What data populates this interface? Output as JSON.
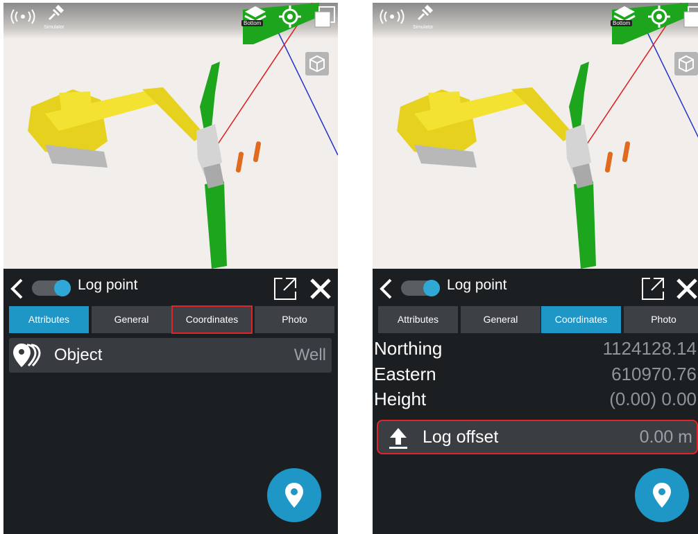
{
  "left_screen": {
    "status": {
      "simulator_label": "Simulator",
      "view_label": "Bottom"
    },
    "header": {
      "title": "Log point"
    },
    "tabs": [
      {
        "label": "Attributes",
        "active": true,
        "highlighted": false
      },
      {
        "label": "General",
        "active": false,
        "highlighted": false
      },
      {
        "label": "Coordinates",
        "active": false,
        "highlighted": true
      },
      {
        "label": "Photo",
        "active": false,
        "highlighted": false
      }
    ],
    "attribute_row": {
      "label": "Object",
      "value": "Well"
    }
  },
  "right_screen": {
    "status": {
      "simulator_label": "Simulator",
      "view_label": "Bottom"
    },
    "header": {
      "title": "Log point"
    },
    "tabs": [
      {
        "label": "Attributes",
        "active": false
      },
      {
        "label": "General",
        "active": false
      },
      {
        "label": "Coordinates",
        "active": true
      },
      {
        "label": "Photo",
        "active": false
      }
    ],
    "coordinates": {
      "northing": {
        "label": "Northing",
        "value": "1124128.14"
      },
      "eastern": {
        "label": "Eastern",
        "value": "610970.76"
      },
      "height": {
        "label": "Height",
        "value": "(0.00) 0.00"
      }
    },
    "log_offset": {
      "label": "Log offset",
      "value": "0.00 m"
    }
  },
  "colors": {
    "accent": "#1e96c6",
    "highlight": "#e0242a",
    "panel_bg": "#1c1f22",
    "tab_bg": "#3d4044"
  },
  "icons": [
    "signal-icon",
    "satellite-icon",
    "layers-icon",
    "locate-icon",
    "windows-icon",
    "cube-icon",
    "back-icon",
    "pin-icon",
    "open-external-icon",
    "close-icon",
    "multi-pin-icon",
    "arrow-up-icon"
  ]
}
